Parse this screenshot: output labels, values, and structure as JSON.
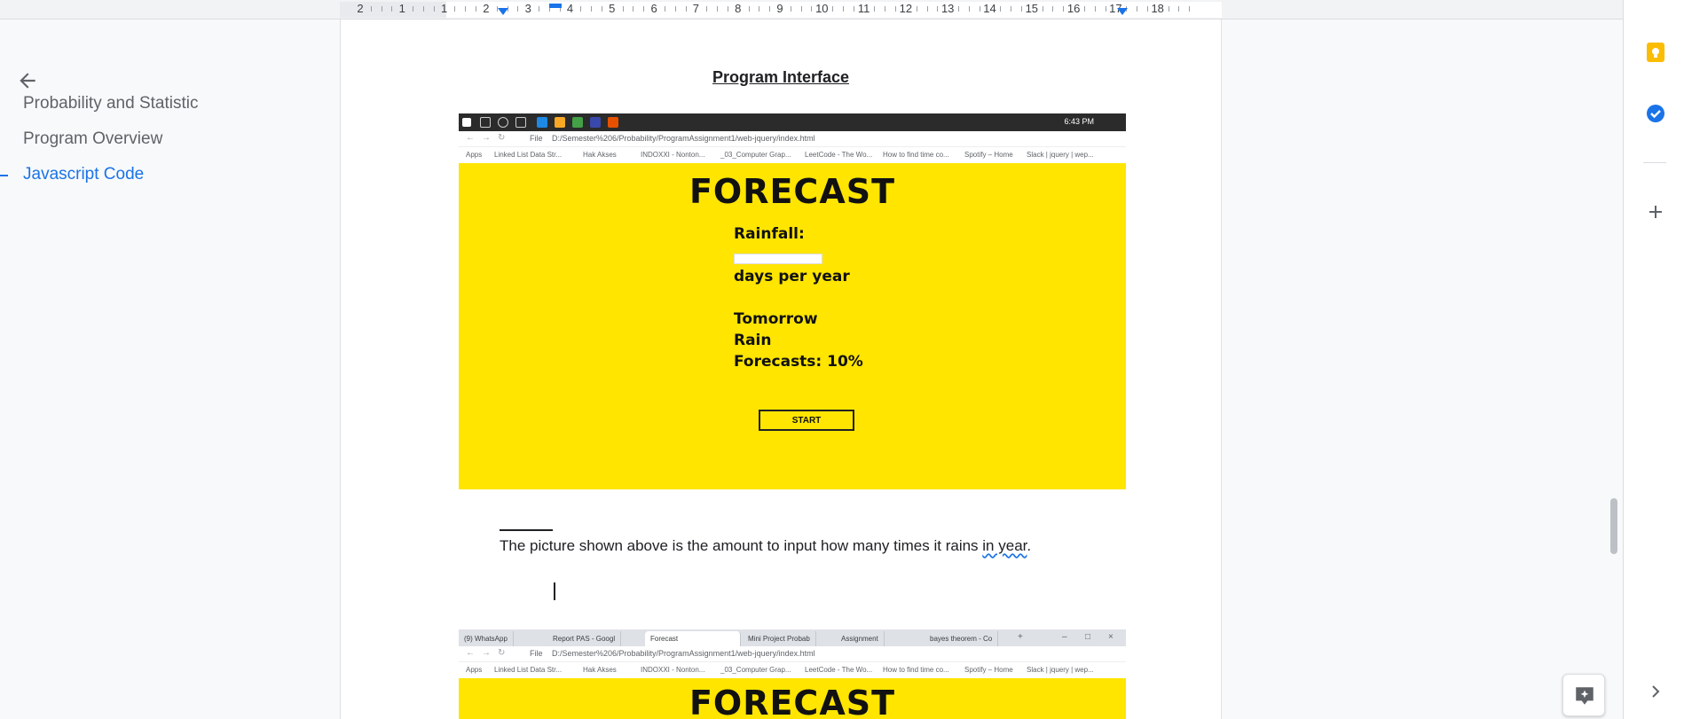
{
  "ruler": {
    "numbers": [
      "2",
      "1",
      "1",
      "2",
      "3",
      "4",
      "5",
      "6",
      "7",
      "8",
      "9",
      "10",
      "11",
      "12",
      "13",
      "14",
      "15",
      "16",
      "17",
      "18"
    ]
  },
  "outline": {
    "items": [
      {
        "label": "Probability and Statistic",
        "active": false
      },
      {
        "label": "Program Overview",
        "active": false
      },
      {
        "label": "Javascript Code",
        "active": true
      }
    ]
  },
  "doc": {
    "heading": "Program Interface",
    "paragraph_before": "The picture shown above is the amount to input how many times it rains ",
    "paragraph_squiggle": "in year",
    "paragraph_after": "."
  },
  "screenshot1": {
    "taskbar_time": "6:43 PM",
    "address": "D:/Semester%206/Probability/ProgramAssignment1/web-jquery/index.html",
    "file_label": "File",
    "bookmarks": [
      "Apps",
      "Linked List Data Str...",
      "Hak Akses",
      "INDOXXI - Nonton...",
      "_03_Computer Grap...",
      "LeetCode - The Wo...",
      "How to find time co...",
      "Spotify – Home",
      "Slack | jquery | wep..."
    ],
    "title": "FORECAST",
    "rainfall_label": "Rainfall:",
    "days_label": "days per year",
    "tomorrow_label": "Tomorrow",
    "rain_label": "Rain",
    "forecast_label": "Forecasts: 10%",
    "start_button": "START"
  },
  "screenshot2": {
    "tabs": [
      "(9) WhatsApp",
      "Report PAS - Googl",
      "Forecast",
      "Mini Project Probab",
      "Assignment",
      "bayes theorem - Co"
    ],
    "active_tab": "Forecast",
    "address": "D:/Semester%206/Probability/ProgramAssignment1/web-jquery/index.html",
    "file_label": "File",
    "bookmarks": [
      "Apps",
      "Linked List Data Str...",
      "Hak Akses",
      "INDOXXI - Nonton...",
      "_03_Computer Grap...",
      "LeetCode - The Wo...",
      "How to find time co...",
      "Spotify – Home",
      "Slack | jquery | wep..."
    ],
    "title": "FORECAST"
  },
  "colors": {
    "accent": "#1a73e8",
    "forecast_bg": "#ffe500",
    "keep_icon": "#fbbc04",
    "tasks_icon": "#1a73e8"
  },
  "icons": {
    "back": "arrow-back-icon",
    "keep": "keep-icon",
    "tasks": "tasks-icon",
    "add": "plus-icon",
    "expand": "chevron-right-icon",
    "explore": "explore-icon"
  }
}
